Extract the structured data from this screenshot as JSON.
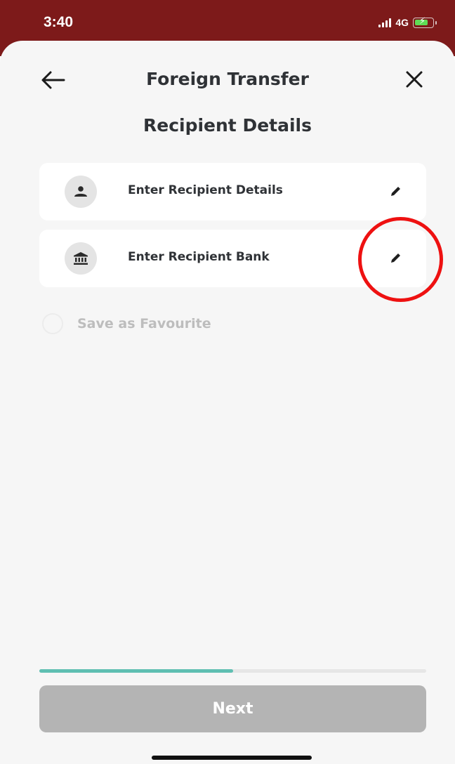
{
  "status_bar": {
    "time": "3:40",
    "network": "4G",
    "icons": [
      "signal-icon",
      "battery-charging-icon"
    ],
    "background_color": "#7d1a1a"
  },
  "header": {
    "title": "Foreign Transfer",
    "back_icon": "arrow-left-icon",
    "close_icon": "close-icon"
  },
  "section_title": "Recipient Details",
  "cards": [
    {
      "label": "Enter Recipient Details",
      "icon": "person-icon",
      "action_icon": "pencil-icon"
    },
    {
      "label": "Enter Recipient Bank",
      "icon": "bank-icon",
      "action_icon": "pencil-icon"
    }
  ],
  "favourite": {
    "label": "Save as Favourite",
    "checked": false
  },
  "progress": {
    "fraction": 0.5,
    "color": "#5fbfb2"
  },
  "next_button": {
    "label": "Next",
    "enabled": false
  },
  "annotation": {
    "type": "circle",
    "color": "#ee1111",
    "target": "Enter Recipient Bank edit button"
  }
}
